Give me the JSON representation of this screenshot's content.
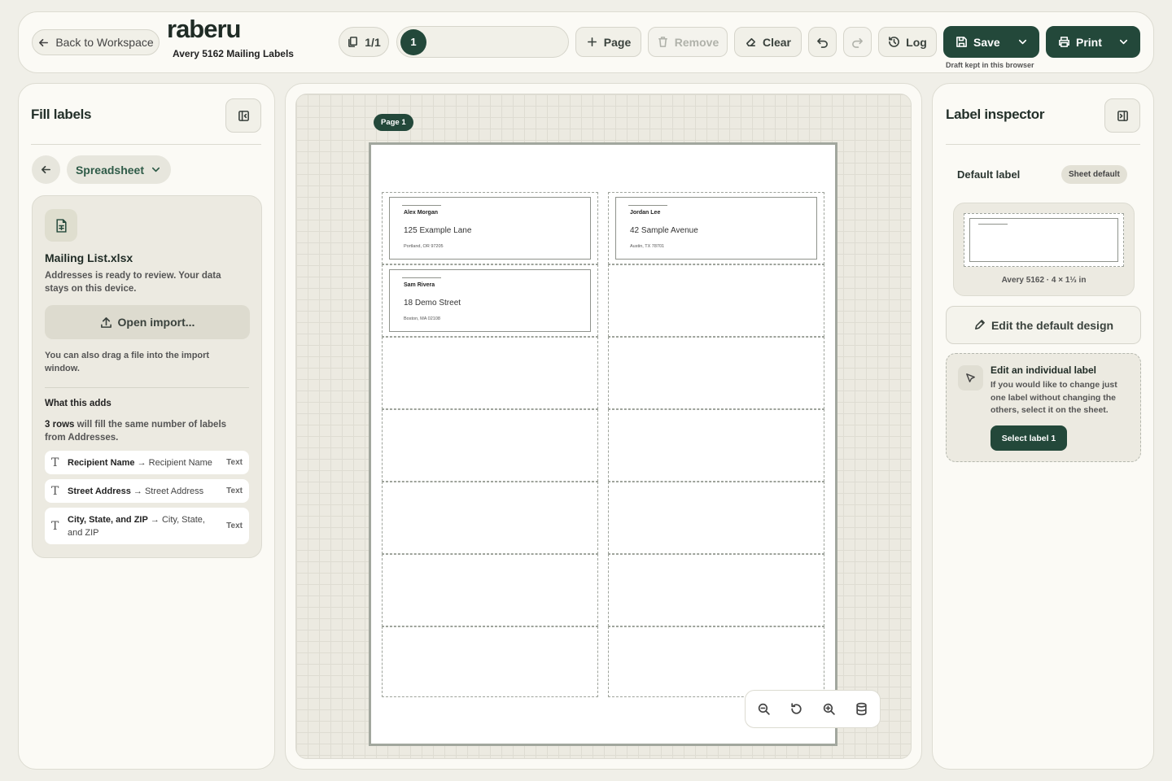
{
  "header": {
    "back_label": "Back to Workspace",
    "logo": "raberu",
    "subtitle": "Avery 5162 Mailing Labels",
    "page_count": "1/1",
    "current_page": "1",
    "add_page_label": "Page",
    "remove_label": "Remove",
    "clear_label": "Clear",
    "log_label": "Log",
    "save_label": "Save",
    "print_label": "Print",
    "draft_note": "Draft kept in this browser"
  },
  "left": {
    "title": "Fill labels",
    "source_label": "Spreadsheet",
    "file_name": "Mailing List.xlsx",
    "file_desc": "Addresses is ready to review. Your data stays on this device.",
    "open_import": "Open import...",
    "drag_hint": "You can also drag a file into the import window.",
    "adds_title": "What this adds",
    "rows_count": "3 rows",
    "rows_text": " will fill the same number of labels from Addresses.",
    "mappings": [
      {
        "from": "Recipient Name",
        "to": "Recipient Name",
        "type": "Text"
      },
      {
        "from": "Street Address",
        "to": "Street Address",
        "type": "Text"
      },
      {
        "from": "City, State, and ZIP",
        "to": "City, State, and ZIP",
        "type": "Text"
      }
    ]
  },
  "canvas": {
    "page_badge": "Page 1",
    "labels": [
      {
        "name": "Alex Morgan",
        "street": "125 Example Lane",
        "city": "Portland, OR 97205"
      },
      {
        "name": "Jordan Lee",
        "street": "42 Sample Avenue",
        "city": "Austin, TX 78701"
      },
      {
        "name": "Sam Rivera",
        "street": "18 Demo Street",
        "city": "Boston, MA 02108"
      }
    ]
  },
  "right": {
    "title": "Label inspector",
    "default_label": "Default label",
    "sheet_default": "Sheet default",
    "preview_caption": "Avery 5162 · 4 × 1⅓ in",
    "edit_default": "Edit the default design",
    "individual_title": "Edit an individual label",
    "individual_desc": "If you would like to change just one label without changing the others, select it on the sheet.",
    "select_label": "Select label 1"
  }
}
